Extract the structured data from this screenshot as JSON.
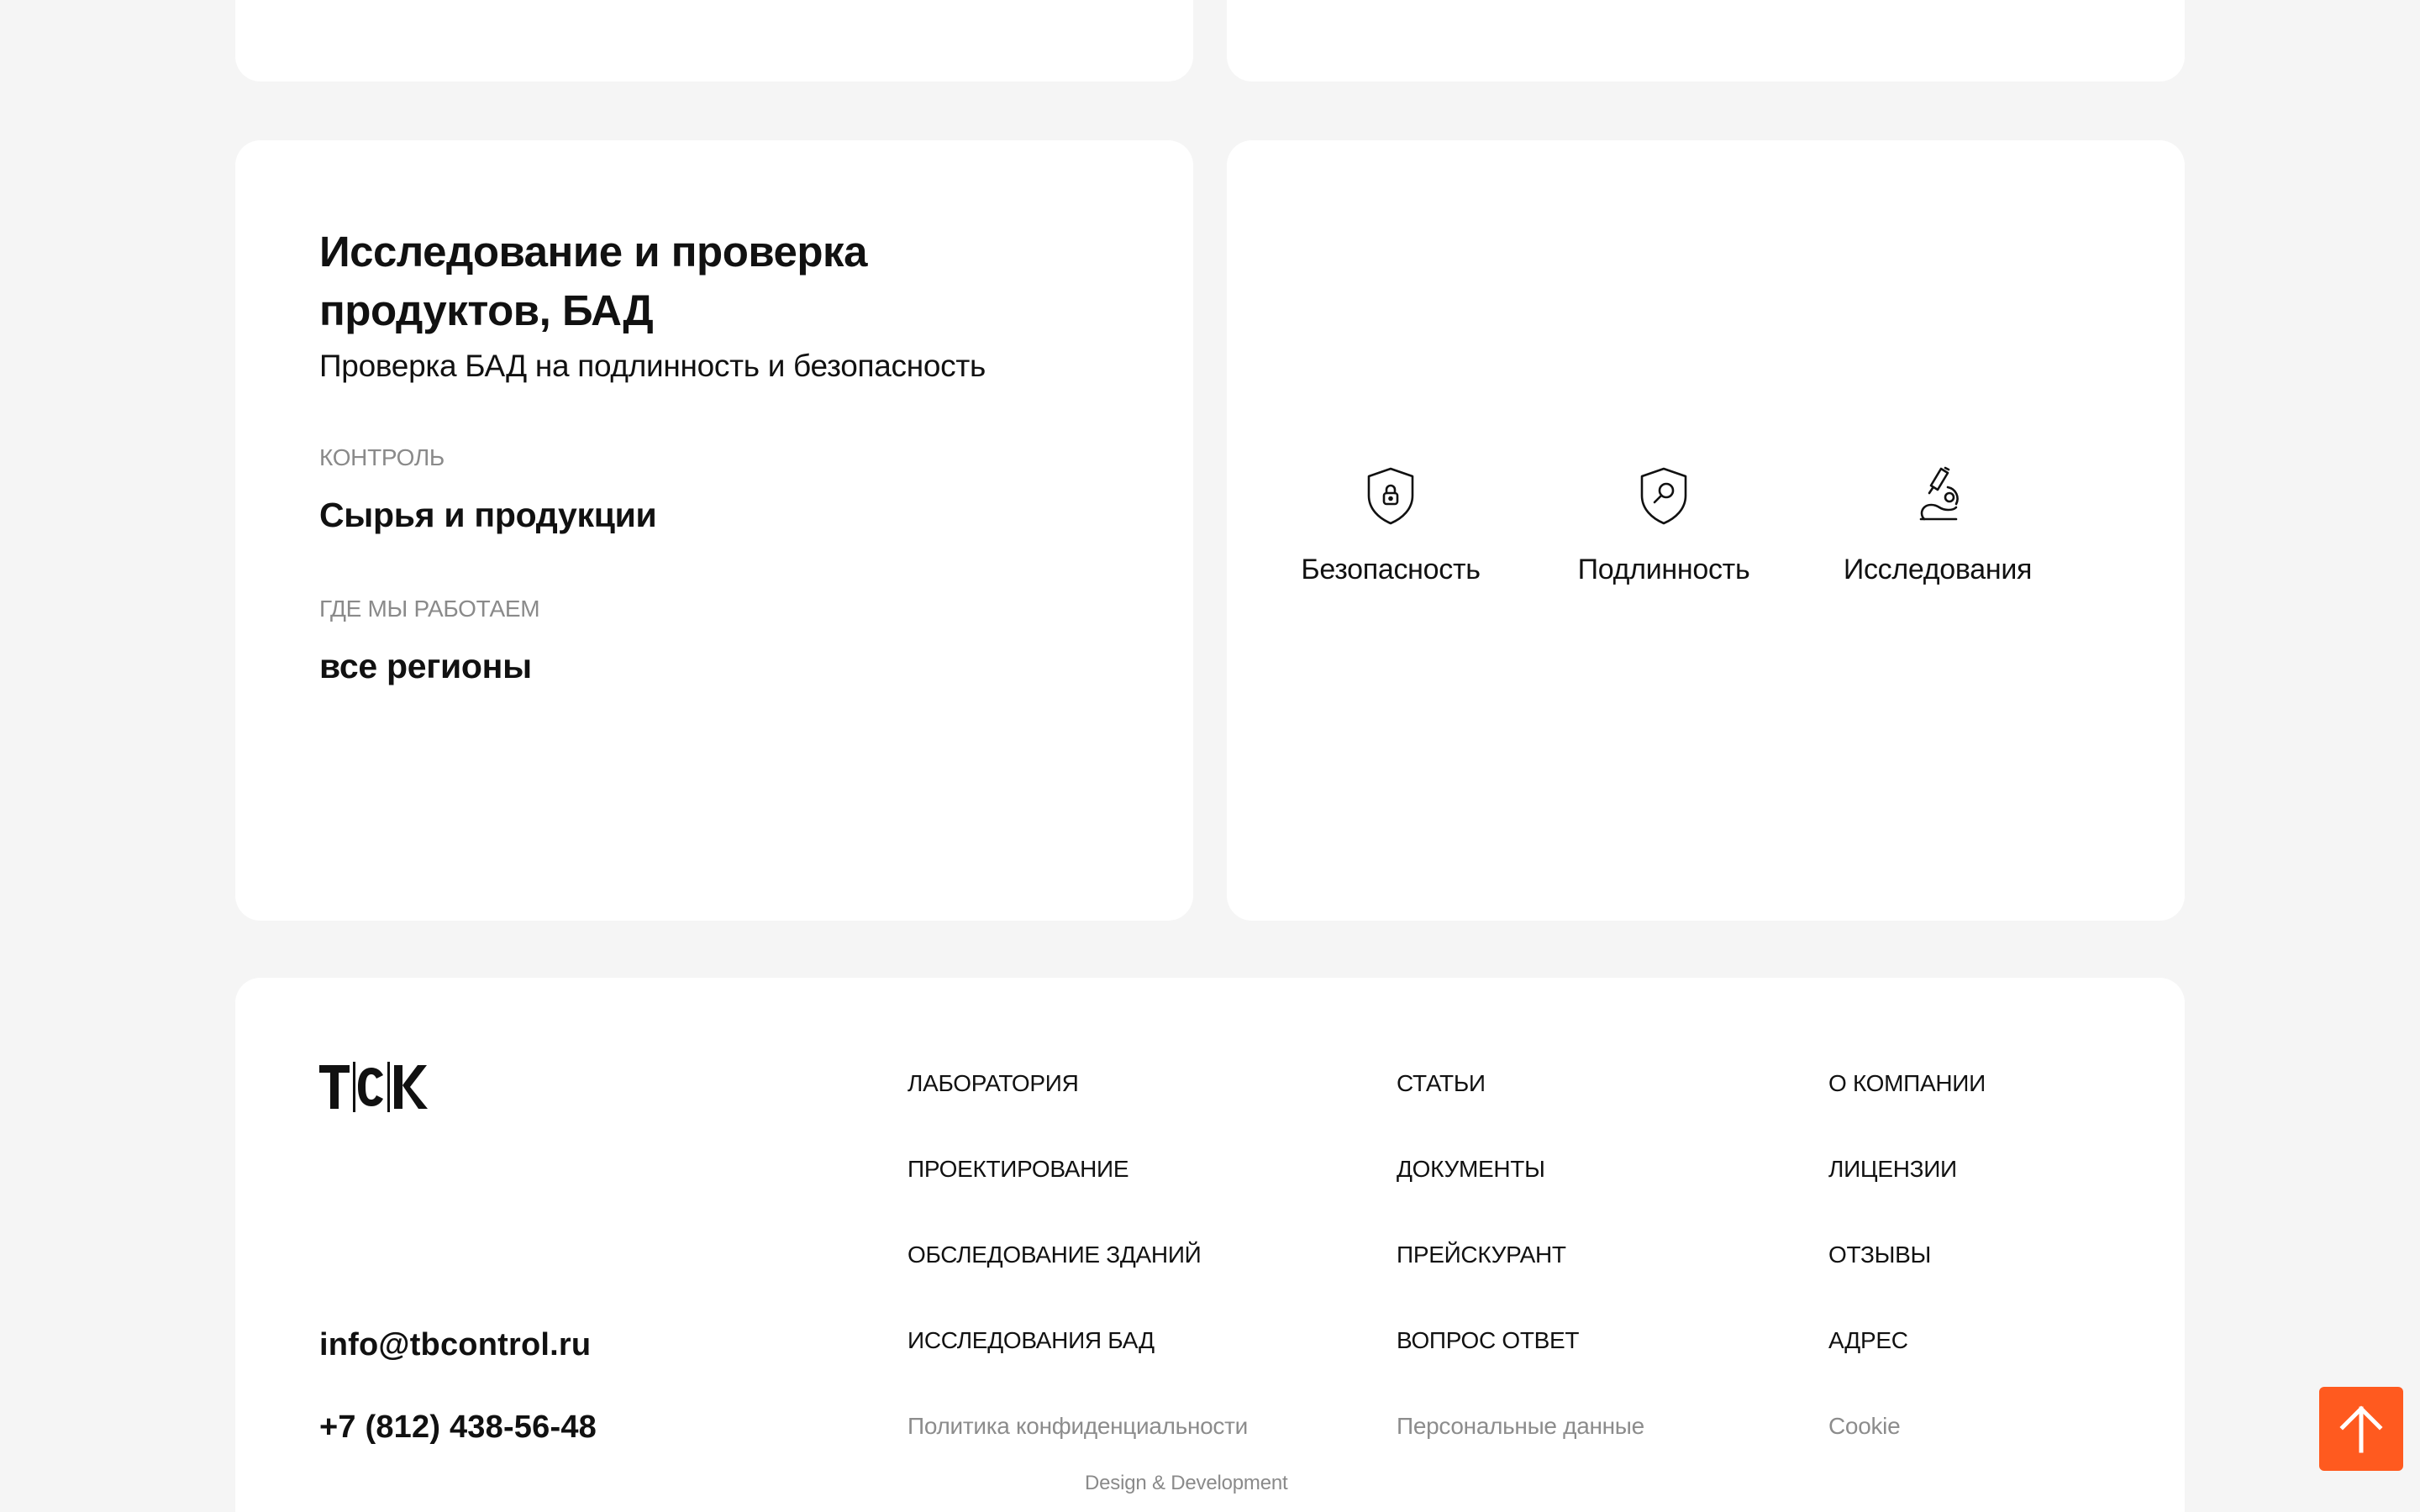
{
  "info": {
    "title": "Исследование и проверка продуктов, БАД",
    "subtitle": "Проверка БАД на подлинность и безопасность",
    "control_label": "КОНТРОЛЬ",
    "control_value": "Сырья и продукции",
    "where_label": "ГДЕ МЫ РАБОТАЕМ",
    "where_value": "все регионы"
  },
  "features": [
    {
      "label": "Безопасность",
      "icon": "shield-lock-icon"
    },
    {
      "label": "Подлинность",
      "icon": "shield-magnifier-icon"
    },
    {
      "label": "Исследования",
      "icon": "microscope-icon"
    }
  ],
  "footer": {
    "logo_text": "TCK",
    "email": "info@tbcontrol.ru",
    "phone": "+7 (812) 438-56-48",
    "nav_col_1": [
      "ЛАБОРАТОРИЯ",
      "ПРОЕКТИРОВАНИЕ",
      "ОБСЛЕДОВАНИЕ ЗДАНИЙ",
      "ИССЛЕДОВАНИЯ БАД",
      "Политика конфиденциальности"
    ],
    "nav_col_2": [
      "СТАТЬИ",
      "ДОКУМЕНТЫ",
      "ПРЕЙСКУРАНТ",
      "ВОПРОС ОТВЕТ",
      "Персональные данные"
    ],
    "nav_col_3": [
      "О КОМПАНИИ",
      "ЛИЦЕНЗИИ",
      "ОТЗЫВЫ",
      "АДРЕС",
      "Cookie"
    ],
    "credit": "Design & Development"
  },
  "scroll_top": {
    "icon": "arrow-up-icon",
    "color": "#ff5a1f"
  }
}
